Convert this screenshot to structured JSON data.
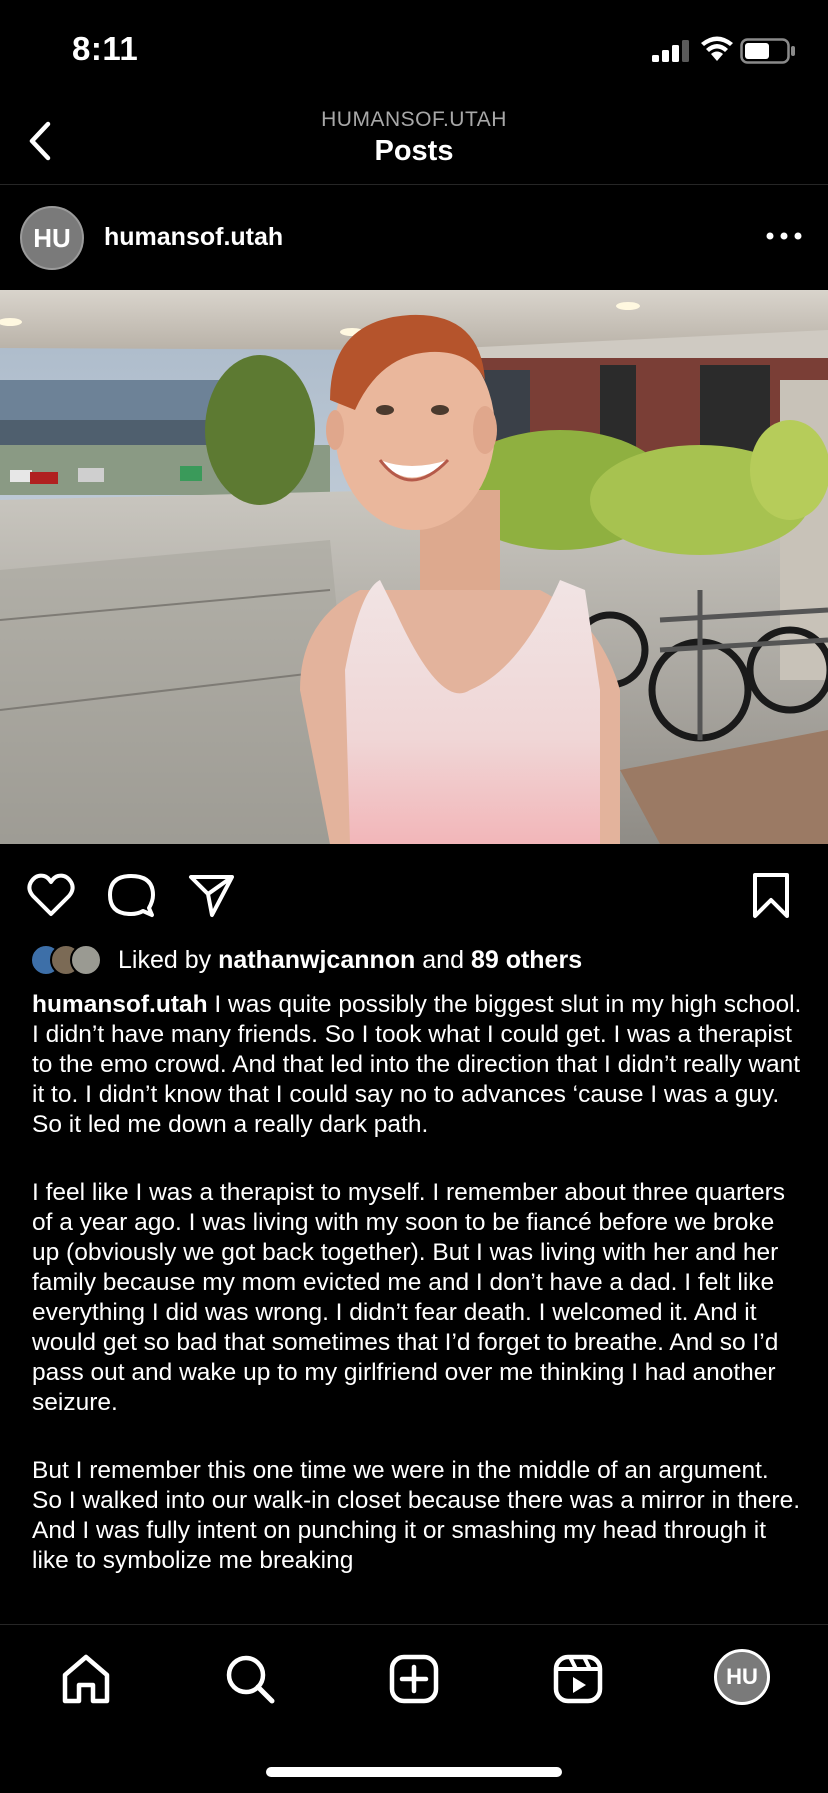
{
  "status_bar": {
    "time": "8:11"
  },
  "header": {
    "account": "HUMANSOF.UTAH",
    "title": "Posts"
  },
  "post": {
    "avatar_initials": "HU",
    "username": "humansof.utah",
    "likes": {
      "prefix": "Liked by",
      "user": "nathanwjcannon",
      "middle": "and",
      "others": "89 others"
    },
    "caption_author": "humansof.utah",
    "caption_paragraphs": [
      "I was quite possibly the biggest slut in my high school. I didn’t have many friends. So I took what I could get. I was a therapist to the emo crowd. And that led into the direction that I didn’t really want it to. I didn’t know that I could say no to advances ‘cause I was a guy. So it led me down a really dark path.",
      "I feel like I was a therapist to myself. I remember about three quarters of a year ago. I was living with my soon to be fiancé before we broke up (obviously we got back together). But I was living with her and her family because my mom evicted me and I don’t have a dad. I felt like everything I did was wrong. I didn’t fear death. I welcomed it. And it would get so bad that sometimes that I’d forget to breathe. And so I’d pass out and wake up to my girlfriend over me thinking I had another seizure.",
      "But I remember this one time we were in the middle of an argument. So I walked into our walk-in closet because there was a mirror in there. And I was fully intent on punching it or smashing my head through it like to symbolize me breaking"
    ]
  },
  "tabbar": {
    "profile_initials": "HU"
  }
}
